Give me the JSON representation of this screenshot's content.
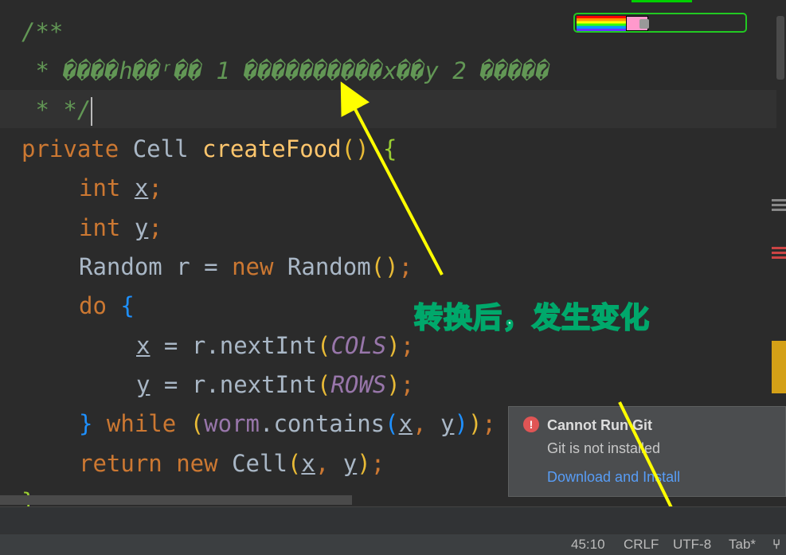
{
  "editor": {
    "lines": {
      "comment_open": "/**",
      "comment_body": " * ����h��ʳ�� 1 ����������x��y 2 �����",
      "comment_close": " * */",
      "l1_kw": "private ",
      "l1_type": "Cell ",
      "l1_fn": "createFood",
      "l1_par": "()",
      "l1_brace": " {",
      "l2_kw": "int ",
      "l2_var": "x",
      "l3_kw": "int ",
      "l3_var": "y",
      "l4_a": "Random r = ",
      "l4_new": "new ",
      "l4_b": "Random",
      "l4_par": "()",
      "l5_kw": "do ",
      "l5_brace": "{",
      "l6_var": "x",
      "l6_a": " = r.nextInt",
      "l6_arg": "COLS",
      "l7_var": "y",
      "l7_a": " = r.nextInt",
      "l7_arg": "ROWS",
      "l8_brace": "} ",
      "l8_kw": "while ",
      "l8_obj": "worm",
      "l8_call": ".contains",
      "l8_x": "x",
      "l8_y": "y",
      "l9_kw": "return ",
      "l9_new": "new ",
      "l9_type": "Cell",
      "l9_x": "x",
      "l9_y": "y",
      "l10": "}"
    }
  },
  "annotation": "转换后，发生变化",
  "notification": {
    "title": "Cannot Run Git",
    "message": "Git is not installed",
    "link": "Download and Install"
  },
  "statusbar": {
    "position": "45:10",
    "line_separator": "CRLF",
    "encoding": "UTF-8",
    "indent": "Tab*"
  },
  "colors": {
    "background": "#2b2b2b",
    "keyword": "#cc7832",
    "comment": "#629755",
    "annotation_arrow": "#ffff00",
    "link": "#589df6"
  }
}
